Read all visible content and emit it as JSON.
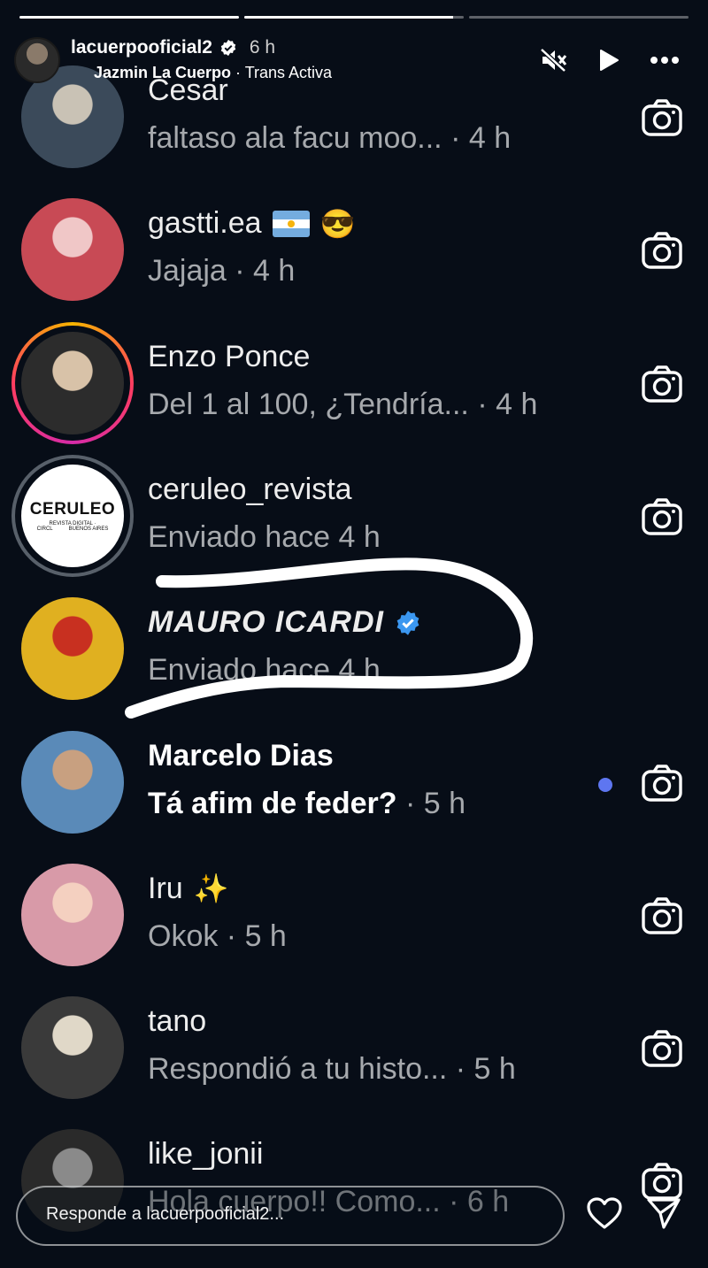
{
  "story": {
    "progress": [
      1.0,
      0.95,
      0.0
    ],
    "username": "lacuerpooficial2",
    "time": "6 h",
    "sub_name": "Jazmin La Cuerpo",
    "sub_sep": " · ",
    "sub_tag": "Trans Activa"
  },
  "conversations": [
    {
      "name": "Cesar",
      "message": "faltaso ala facu moo...",
      "time": "· 4 h",
      "ring": "none",
      "unread": false,
      "camera": true,
      "avatar_colors": [
        "#3b4a5a",
        "#c9c2b5"
      ]
    },
    {
      "name": "gastti.ea",
      "message": "Jajaja · 4 h",
      "time": "",
      "ring": "none",
      "unread": false,
      "camera": true,
      "emoji": "😎",
      "flag": "argentina-flag",
      "avatar_colors": [
        "#c84a55",
        "#f0c7c7"
      ]
    },
    {
      "name": "Enzo Ponce",
      "message": "Del 1 al 100, ¿Tendría...",
      "time": "· 4 h",
      "ring": "story",
      "unread": false,
      "camera": true,
      "avatar_colors": [
        "#2c2c2c",
        "#d8c2a8"
      ]
    },
    {
      "name": "ceruleo_revista",
      "message": "Enviado hace 4 h",
      "time": "",
      "ring": "seen",
      "unread": false,
      "camera": true,
      "logo": {
        "title": "CERULEO",
        "line1": "REVISTA DIGITAL ·",
        "line2a": "CIRCL",
        "line2b": "BUENOS AIRES"
      }
    },
    {
      "name": "MAURO ICARDI",
      "message": "Enviado hace 4 h",
      "time": "",
      "ring": "none",
      "unread": false,
      "camera": false,
      "verified": true,
      "avatar_colors": [
        "#e0b020",
        "#c83020"
      ]
    },
    {
      "name": "Marcelo Dias",
      "message": "Tá afim de feder?",
      "time": "· 5 h",
      "ring": "none",
      "unread": true,
      "camera": true,
      "avatar_colors": [
        "#5a8ab8",
        "#c8a080"
      ]
    },
    {
      "name": "Iru",
      "message": "Okok · 5 h",
      "time": "",
      "ring": "none",
      "unread": false,
      "camera": true,
      "emoji": "✨",
      "avatar_colors": [
        "#d89aa8",
        "#f4d0c0"
      ]
    },
    {
      "name": "tano",
      "message": "Respondió a tu histo...",
      "time": "· 5 h",
      "ring": "none",
      "unread": false,
      "camera": true,
      "avatar_colors": [
        "#3a3a3a",
        "#e0d8c8"
      ]
    },
    {
      "name": "like_jonii",
      "message": "Hola cuerpo!! Como...",
      "time": "· 6 h",
      "ring": "none",
      "unread": false,
      "camera": true,
      "avatar_colors": [
        "#2a2a2a",
        "#8a8a8a"
      ]
    }
  ],
  "reply": {
    "placeholder": "Responde a lacuerpooficial2..."
  },
  "colors": {
    "background": "#070d17",
    "unread_dot": "#5e76f0",
    "verified": "#3b97f0"
  }
}
